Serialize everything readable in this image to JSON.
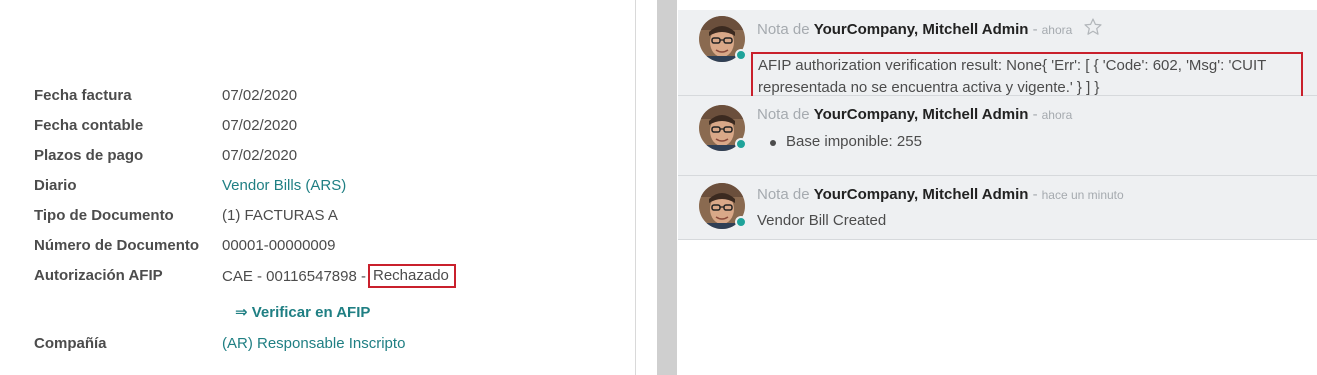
{
  "form": {
    "fields": [
      {
        "label": "Fecha factura",
        "value": "07/02/2020"
      },
      {
        "label": "Fecha contable",
        "value": "07/02/2020"
      },
      {
        "label": "Plazos de pago",
        "value": "07/02/2020"
      },
      {
        "label": "Diario",
        "value": "Vendor Bills (ARS)"
      },
      {
        "label": "Tipo de Documento",
        "value": "(1) FACTURAS A"
      },
      {
        "label": "Número de Documento",
        "value": "00001-00000009"
      }
    ],
    "afip": {
      "label": "Autorización AFIP",
      "cae": "CAE - 00116547898 -",
      "status": "Rechazado"
    },
    "verify_button": "⇒ Verificar en AFIP",
    "company": {
      "label": "Compañía",
      "value": "(AR) Responsable Inscripto"
    }
  },
  "chatter": {
    "messages": [
      {
        "prefix": "Nota de",
        "author": "YourCompany, Mitchell Admin",
        "separator": "-",
        "time": "ahora",
        "body": "AFIP authorization verification result: None{ 'Err': [ { 'Code': 602, 'Msg': 'CUIT representada no se encuentra activa y vigente.' } ] }"
      },
      {
        "prefix": "Nota de",
        "author": "YourCompany, Mitchell Admin",
        "separator": "-",
        "time": "ahora",
        "bullet": "Base imponible: 255"
      },
      {
        "prefix": "Nota de",
        "author": "YourCompany, Mitchell Admin",
        "separator": "-",
        "time": "hace un minuto",
        "body": "Vendor Bill Created"
      }
    ]
  },
  "colors": {
    "link": "#1f7f83",
    "highlight_border": "#c9202c",
    "presence_online": "#1fa39a",
    "message_bg": "#eef0f2"
  }
}
